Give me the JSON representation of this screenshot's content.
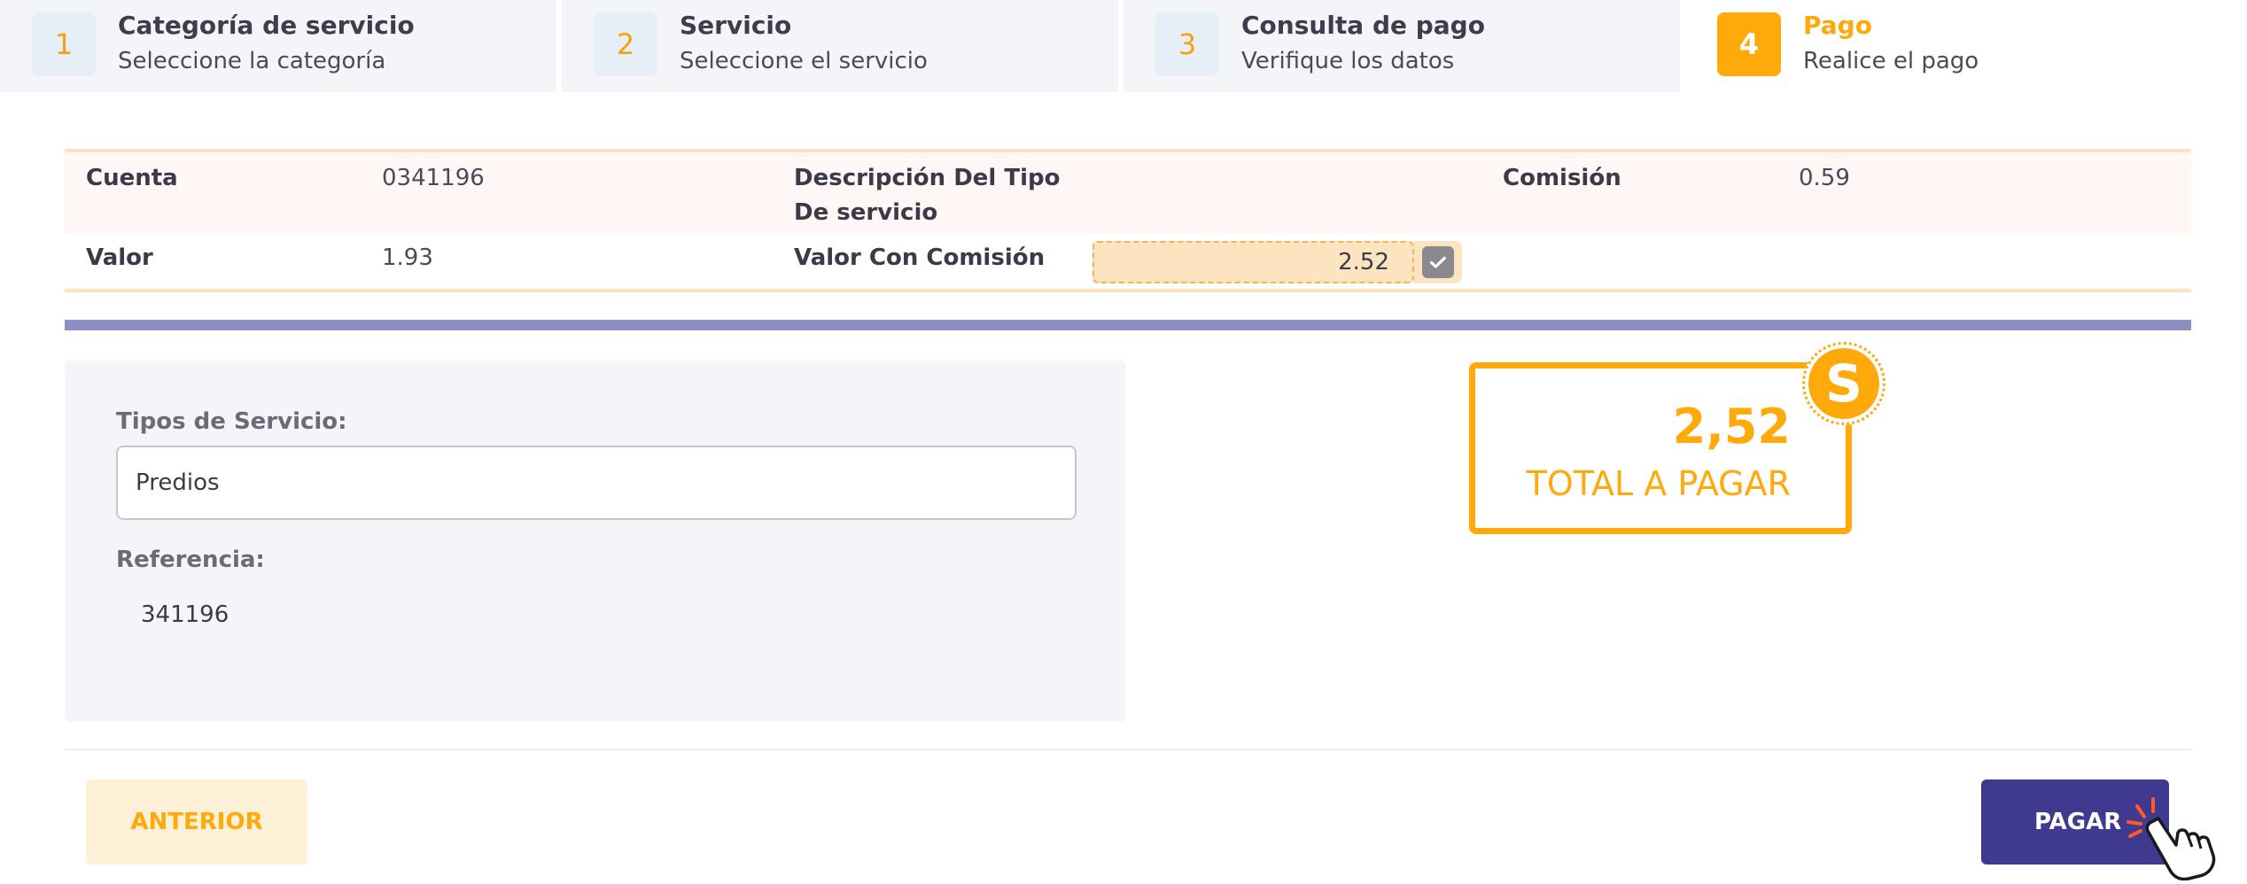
{
  "steps": [
    {
      "num": "1",
      "title": "Categoría de servicio",
      "subtitle": "Seleccione la categoría",
      "active": false
    },
    {
      "num": "2",
      "title": "Servicio",
      "subtitle": "Seleccione el servicio",
      "active": false
    },
    {
      "num": "3",
      "title": "Consulta de pago",
      "subtitle": "Verifique los datos",
      "active": false
    },
    {
      "num": "4",
      "title": "Pago",
      "subtitle": "Realice el pago",
      "active": true
    }
  ],
  "info": {
    "cuenta_label": "Cuenta",
    "cuenta_value": "0341196",
    "desc_label_line1": "Descripción Del Tipo",
    "desc_label_line2": "De servicio",
    "comision_label": "Comisión",
    "comision_value": "0.59",
    "valor_label": "Valor",
    "valor_value": "1.93",
    "valor_comision_label": "Valor Con Comisión",
    "valor_comision_value": "2.52"
  },
  "form": {
    "tipos_label": "Tipos de Servicio:",
    "tipos_value": "Predios",
    "referencia_label": "Referencia:",
    "referencia_value": "341196"
  },
  "total": {
    "amount": "2,52",
    "label": "TOTAL A PAGAR",
    "coin_symbol": "S"
  },
  "buttons": {
    "prev_label": "ANTERIOR",
    "pay_label": "PAGAR"
  },
  "colors": {
    "accent": "#ffa90a",
    "primary": "#3f3a8f",
    "divider": "#8b8fc4"
  },
  "icons": {
    "check": "check-icon",
    "coin": "dollar-coin-icon",
    "cursor": "hand-pointer-icon"
  }
}
